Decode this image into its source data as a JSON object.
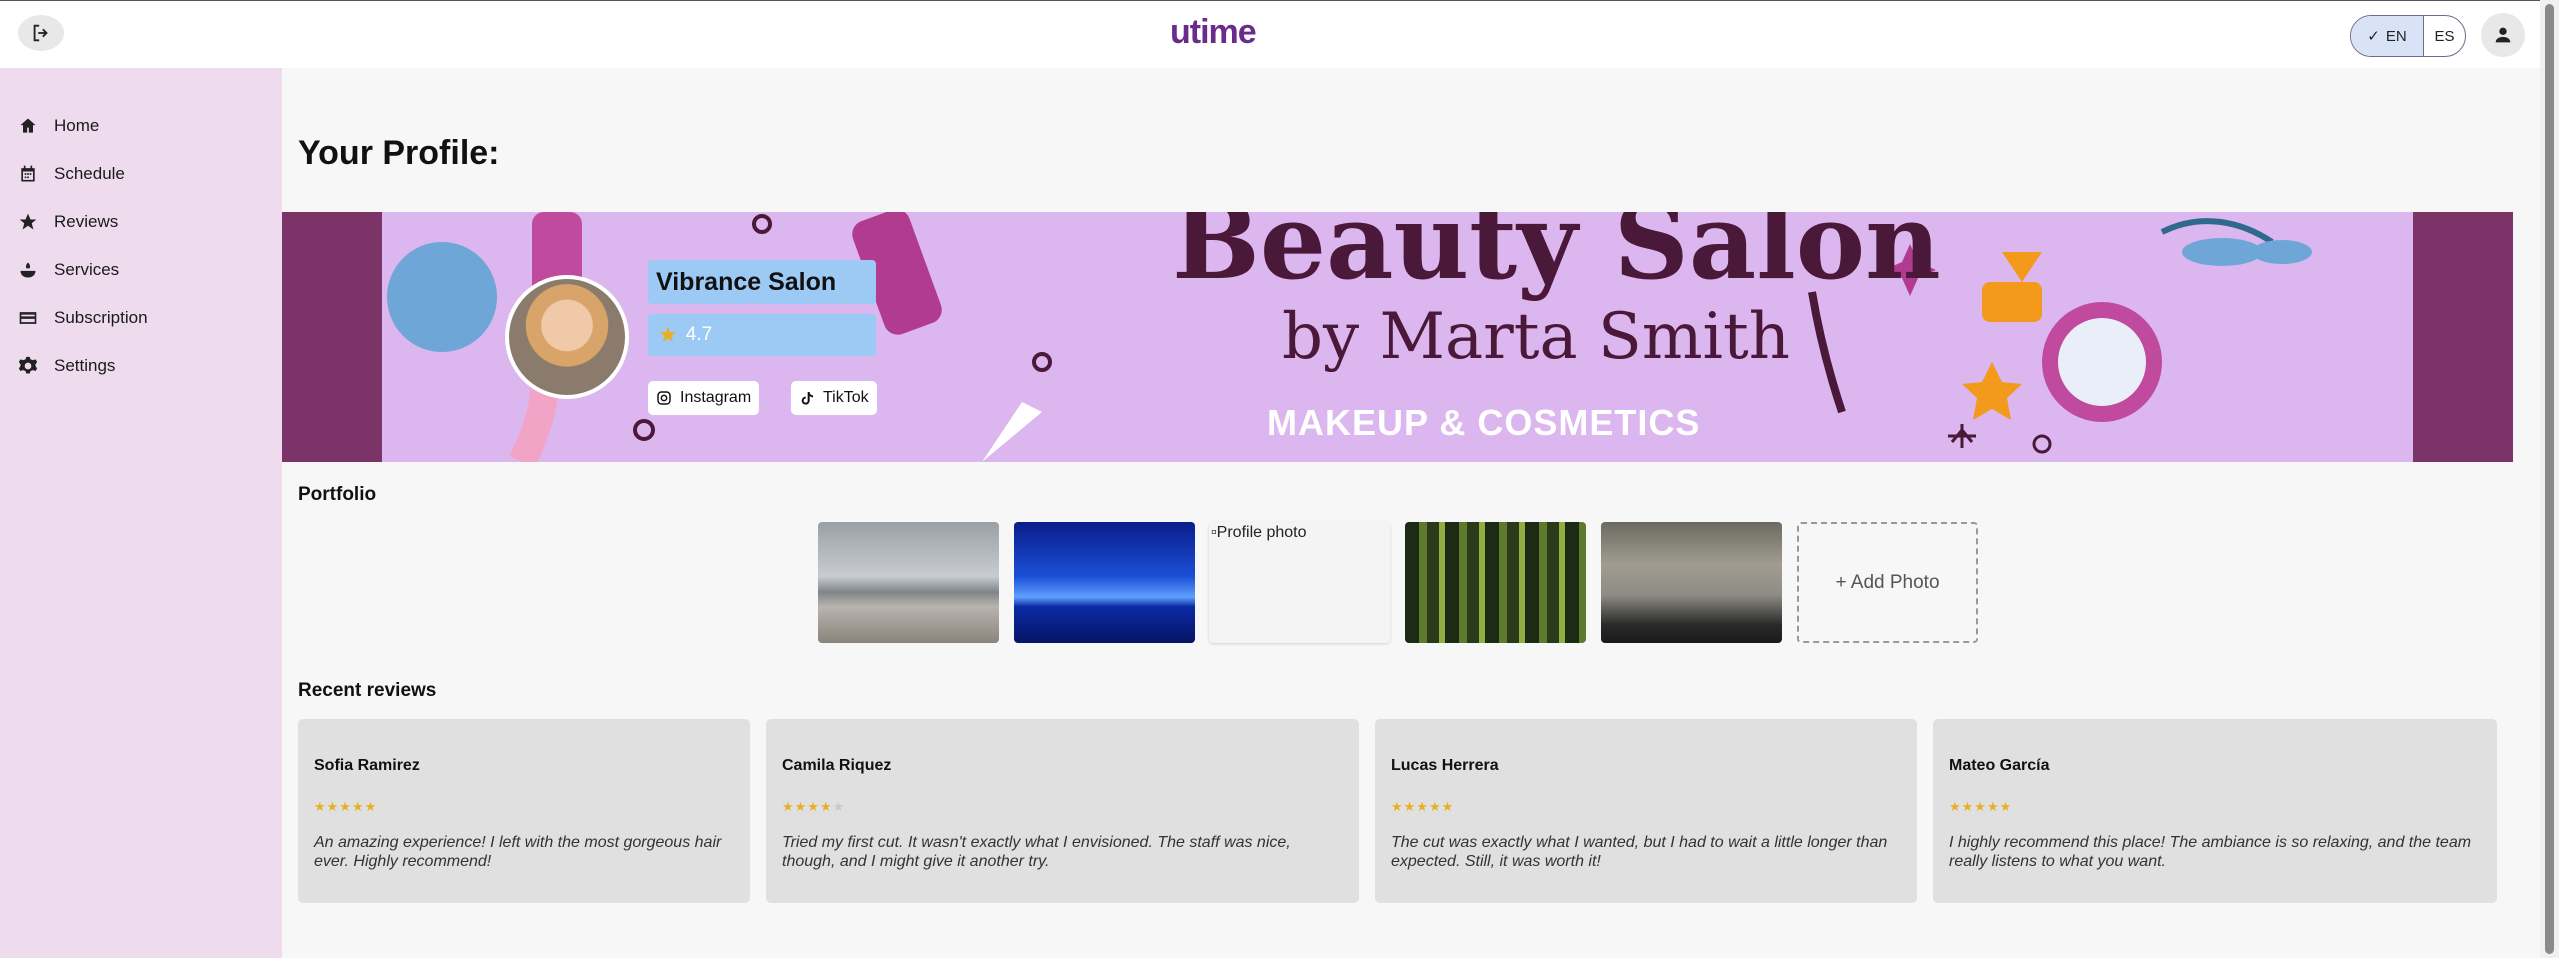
{
  "header": {
    "logo": "utime",
    "lang_en": "EN",
    "lang_es": "ES"
  },
  "sidebar": {
    "items": [
      {
        "label": "Home",
        "icon": "home-icon"
      },
      {
        "label": "Schedule",
        "icon": "calendar-icon"
      },
      {
        "label": "Reviews",
        "icon": "star-icon"
      },
      {
        "label": "Services",
        "icon": "services-icon"
      },
      {
        "label": "Subscription",
        "icon": "card-icon"
      },
      {
        "label": "Settings",
        "icon": "gear-icon"
      }
    ]
  },
  "main": {
    "title": "Your Profile:",
    "banner": {
      "title": "Beauty Salon",
      "subtitle": "by Marta Smith",
      "tagline": "MAKEUP & COSMETICS"
    },
    "profile": {
      "name": "Vibrance Salon",
      "rating": "4.7",
      "instagram": "Instagram",
      "tiktok": "TikTok"
    },
    "portfolio": {
      "title": "Portfolio",
      "missing_alt": "Profile photo",
      "add_label": "+ Add Photo"
    },
    "reviews": {
      "title": "Recent reviews",
      "items": [
        {
          "name": "Sofia Ramirez",
          "stars": 5,
          "text": "An amazing experience! I left with the most gorgeous hair ever. Highly recommend!"
        },
        {
          "name": "Camila Riquez",
          "stars": 4,
          "text": "Tried my first cut. It wasn't exactly what I envisioned. The staff was nice, though, and I might give it another try."
        },
        {
          "name": "Lucas Herrera",
          "stars": 5,
          "text": "The cut was exactly what I wanted, but I had to wait a little longer than expected. Still, it was worth it!"
        },
        {
          "name": "Mateo García",
          "stars": 5,
          "text": "I highly recommend this place! The ambiance is so relaxing, and the team really listens to what you want."
        }
      ]
    }
  },
  "colors": {
    "sidebar_bg": "#eedcee",
    "accent": "#6a2c8a",
    "profile_chip": "#9ccaf5",
    "star": "#e8b020"
  }
}
